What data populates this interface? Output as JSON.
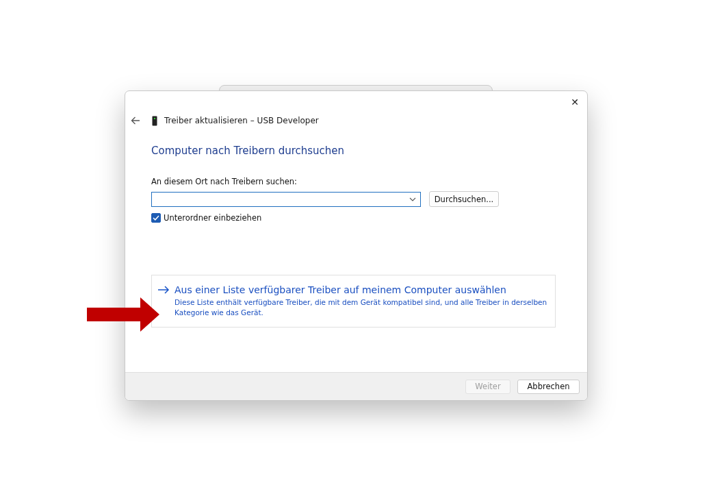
{
  "window": {
    "title": "Treiber aktualisieren – USB Developer",
    "close": "✕"
  },
  "heading": "Computer nach Treibern durchsuchen",
  "location": {
    "label": "An diesem Ort nach Treibern suchen:",
    "browse_button": "Durchsuchen..."
  },
  "include_subfolders": {
    "label": "Unterordner einbeziehen",
    "checked": true
  },
  "option_link": {
    "title": "Aus einer Liste verfügbarer Treiber auf meinem Computer auswählen",
    "description": "Diese Liste enthält verfügbare Treiber, die mit dem Gerät kompatibel sind, und alle Treiber in derselben Kategorie wie das Gerät."
  },
  "buttons": [
    {
      "label": "Weiter",
      "disabled": true
    },
    {
      "label": "Abbrechen",
      "disabled": false
    }
  ]
}
